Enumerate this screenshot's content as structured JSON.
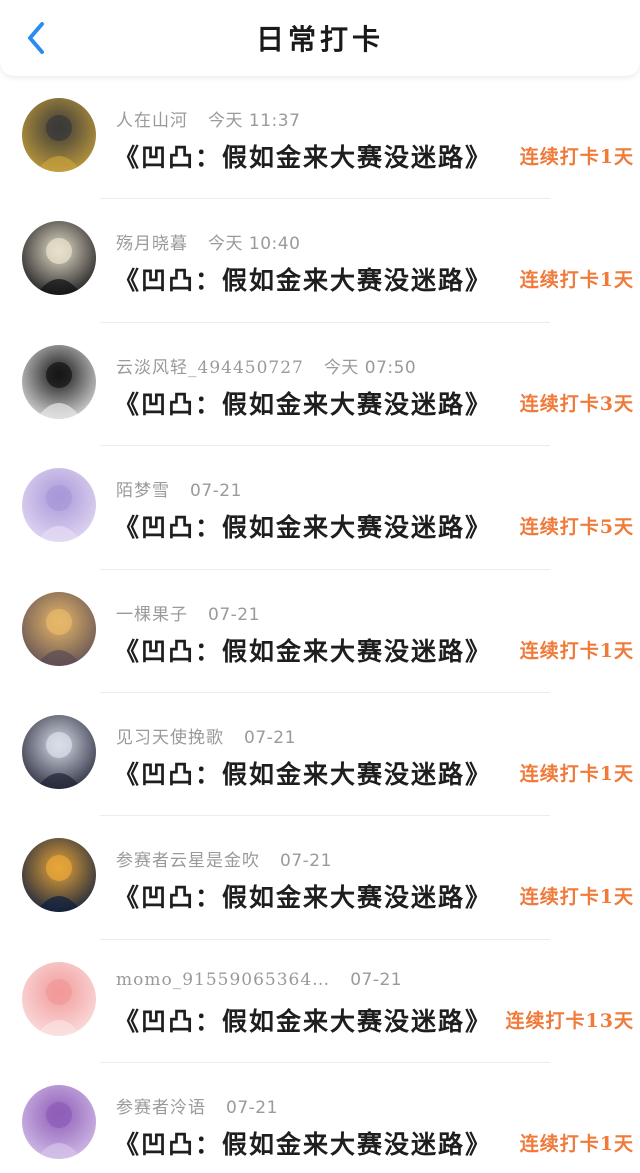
{
  "header": {
    "title": "日常打卡",
    "back_icon": "chevron-left-icon"
  },
  "colors": {
    "accent": "#2a8cf0",
    "streak": "#f07a3a",
    "meta": "#9a9a9a",
    "divider": "#ececec"
  },
  "items": [
    {
      "user": "人在山河",
      "time": "今天 11:37",
      "title": "《凹凸：假如金来大赛没迷路》",
      "streak": "连续打卡1天",
      "avatar": [
        "#c9a23c",
        "#3a3a3a"
      ]
    },
    {
      "user": "殇月晓暮",
      "time": "今天 10:40",
      "title": "《凹凸：假如金来大赛没迷路》",
      "streak": "连续打卡1天",
      "avatar": [
        "#0e0e12",
        "#e8e0cc"
      ]
    },
    {
      "user": "云淡风轻_494450727",
      "time": "今天 07:50",
      "title": "《凹凸：假如金来大赛没迷路》",
      "streak": "连续打卡3天",
      "avatar": [
        "#e8e8e8",
        "#151515"
      ]
    },
    {
      "user": "陌梦雪",
      "time": "07-21",
      "title": "《凹凸：假如金来大赛没迷路》",
      "streak": "连续打卡5天",
      "avatar": [
        "#e6dcf5",
        "#a898d8"
      ]
    },
    {
      "user": "一棵果子",
      "time": "07-21",
      "title": "《凹凸：假如金来大赛没迷路》",
      "streak": "连续打卡1天",
      "avatar": [
        "#5a4a52",
        "#e7b86a"
      ]
    },
    {
      "user": "见习天使挽歌",
      "time": "07-21",
      "title": "《凹凸：假如金来大赛没迷路》",
      "streak": "连续打卡1天",
      "avatar": [
        "#1e2233",
        "#d9dde8"
      ]
    },
    {
      "user": "参赛者云星是金吹",
      "time": "07-21",
      "title": "《凹凸：假如金来大赛没迷路》",
      "streak": "连续打卡1天",
      "avatar": [
        "#0c1c3c",
        "#e8a53a"
      ]
    },
    {
      "user": "momo_91559065364…",
      "time": "07-21",
      "title": "《凹凸：假如金来大赛没迷路》",
      "streak": "连续打卡13天",
      "avatar": [
        "#fbe3e3",
        "#f29a9a"
      ]
    },
    {
      "user": "参赛者泠语",
      "time": "07-21",
      "title": "《凹凸：假如金来大赛没迷路》",
      "streak": "连续打卡1天",
      "avatar": [
        "#d6c4ea",
        "#8f5db8"
      ]
    }
  ]
}
